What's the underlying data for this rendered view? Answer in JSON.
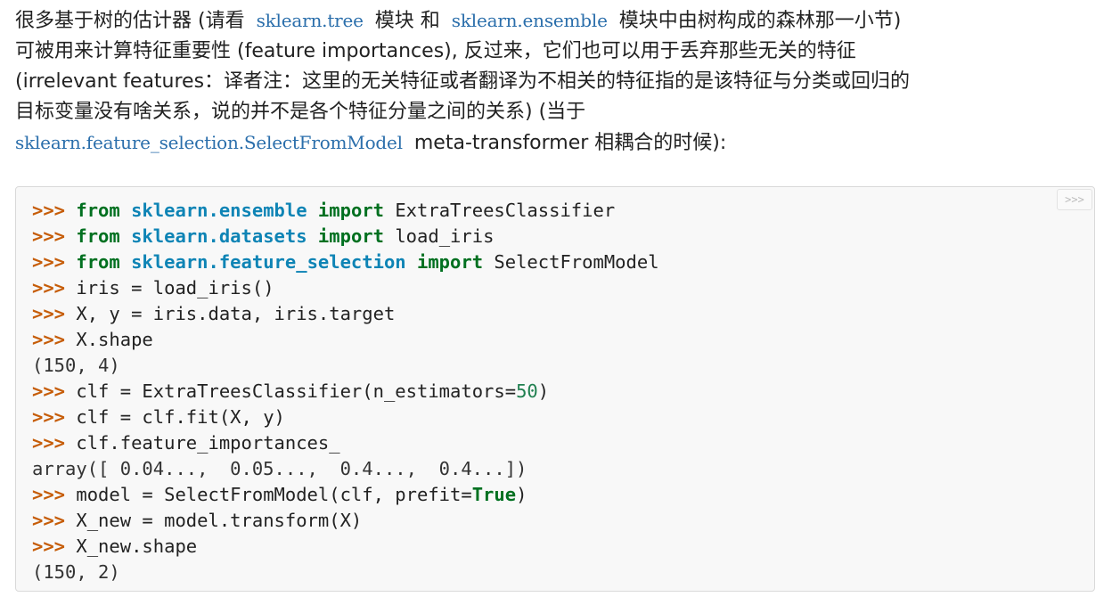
{
  "paragraph": {
    "l1_a": "很多基于树的估计器 (请看 ",
    "l1_code1": "sklearn.tree",
    "l1_b": " 模块 和 ",
    "l1_code2": "sklearn.ensemble",
    "l1_c": " 模块中由树构成的森林那一小节)",
    "l2": "可被用来计算特征重要性 (feature importances), 反过来，它们也可以用于丢弃那些无关的特征",
    "l3": "(irrelevant features：译者注：这里的无关特征或者翻译为不相关的特征指的是该特征与分类或回归的",
    "l4": "目标变量没有啥关系，说的并不是各个特征分量之间的关系) (当于",
    "l5_code": "sklearn.feature_selection.SelectFromModel",
    "l5_text": " meta-transformer 相耦合的时候):"
  },
  "code": {
    "copy_button": ">>>",
    "prompt": ">>> ",
    "kw_from": "from",
    "kw_import": "import",
    "l1_mod": "sklearn.ensemble",
    "l1_name": "ExtraTreesClassifier",
    "l2_mod": "sklearn.datasets",
    "l2_name": "load_iris",
    "l3_mod": "sklearn.feature_selection",
    "l3_name": "SelectFromModel",
    "l4": "iris = load_iris()",
    "l5": "X, y = iris.data, iris.target",
    "l6": "X.shape",
    "o1": "(150, 4)",
    "l7_a": "clf = ExtraTreesClassifier(n_estimators=",
    "l7_num": "50",
    "l7_b": ")",
    "l8": "clf = clf.fit(X, y)",
    "l9": "clf.feature_importances_",
    "o2": "array([ 0.04...,  0.05...,  0.4...,  0.4...])",
    "l10_a": "model = SelectFromModel(clf, prefit=",
    "l10_const": "True",
    "l10_b": ")",
    "l11": "X_new = model.transform(X)",
    "l12": "X_new.shape",
    "o3": "(150, 2)"
  }
}
